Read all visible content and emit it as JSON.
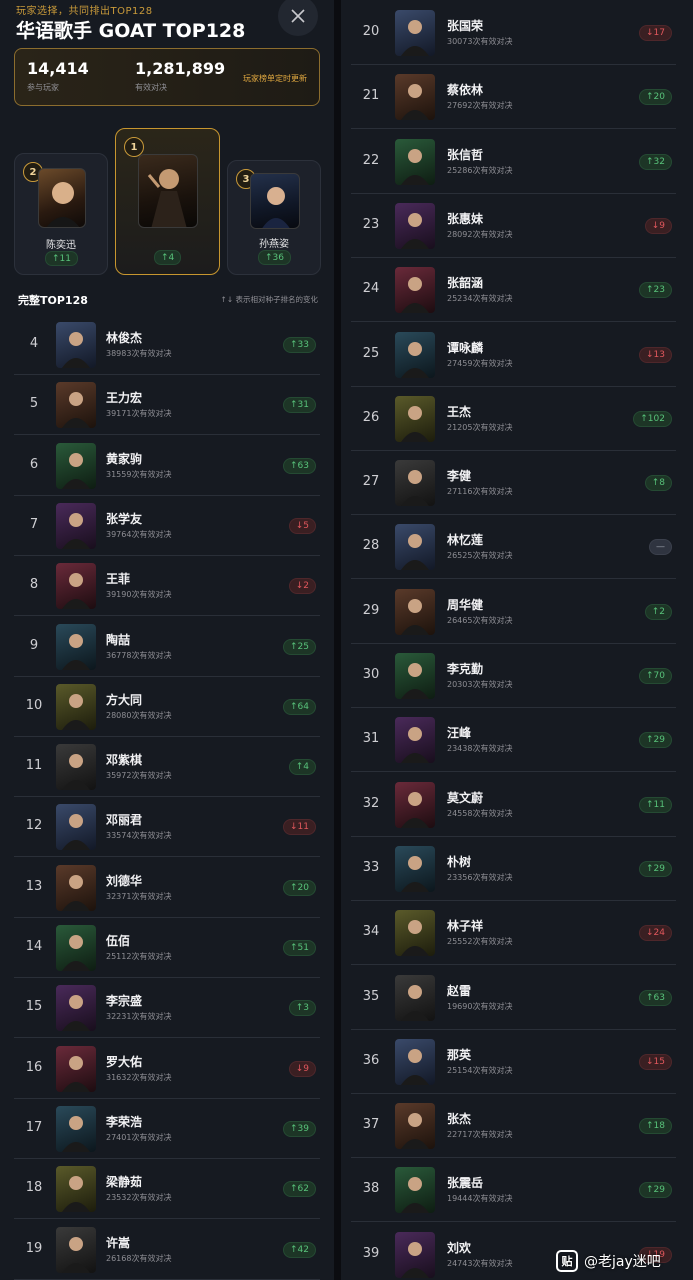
{
  "header": {
    "subtitle": "玩家选择，共同排出TOP128",
    "title": "华语歌手 GOAT TOP128",
    "close_icon": "close-icon"
  },
  "stats": {
    "players": "14,414",
    "players_label": "参与玩家",
    "matches": "1,281,899",
    "matches_label": "有效对决",
    "note": "玩家榜单定时更新"
  },
  "podium": [
    {
      "rank": "2",
      "name": "陈奕迅",
      "change": "↑11",
      "dir": "up"
    },
    {
      "rank": "1",
      "name": "",
      "change": "↑4",
      "dir": "up"
    },
    {
      "rank": "3",
      "name": "孙燕姿",
      "change": "↑36",
      "dir": "up"
    }
  ],
  "section": {
    "title": "完整TOP128",
    "note": "↑↓ 表示相对种子排名的变化"
  },
  "rows": [
    {
      "rank": "4",
      "name": "林俊杰",
      "count": "38983次有效对决",
      "change": "↑33",
      "dir": "up"
    },
    {
      "rank": "5",
      "name": "王力宏",
      "count": "39171次有效对决",
      "change": "↑31",
      "dir": "up"
    },
    {
      "rank": "6",
      "name": "黄家驹",
      "count": "31559次有效对决",
      "change": "↑63",
      "dir": "up"
    },
    {
      "rank": "7",
      "name": "张学友",
      "count": "39764次有效对决",
      "change": "↓5",
      "dir": "down"
    },
    {
      "rank": "8",
      "name": "王菲",
      "count": "39190次有效对决",
      "change": "↓2",
      "dir": "down"
    },
    {
      "rank": "9",
      "name": "陶喆",
      "count": "36778次有效对决",
      "change": "↑25",
      "dir": "up"
    },
    {
      "rank": "10",
      "name": "方大同",
      "count": "28080次有效对决",
      "change": "↑64",
      "dir": "up"
    },
    {
      "rank": "11",
      "name": "邓紫棋",
      "count": "35972次有效对决",
      "change": "↑4",
      "dir": "up"
    },
    {
      "rank": "12",
      "name": "邓丽君",
      "count": "33574次有效对决",
      "change": "↓11",
      "dir": "down"
    },
    {
      "rank": "13",
      "name": "刘德华",
      "count": "32371次有效对决",
      "change": "↑20",
      "dir": "up"
    },
    {
      "rank": "14",
      "name": "伍佰",
      "count": "25112次有效对决",
      "change": "↑51",
      "dir": "up"
    },
    {
      "rank": "15",
      "name": "李宗盛",
      "count": "32231次有效对决",
      "change": "↑3",
      "dir": "up"
    },
    {
      "rank": "16",
      "name": "罗大佑",
      "count": "31632次有效对决",
      "change": "↓9",
      "dir": "down"
    },
    {
      "rank": "17",
      "name": "李荣浩",
      "count": "27401次有效对决",
      "change": "↑39",
      "dir": "up"
    },
    {
      "rank": "18",
      "name": "梁静茹",
      "count": "23532次有效对决",
      "change": "↑62",
      "dir": "up"
    },
    {
      "rank": "19",
      "name": "许嵩",
      "count": "26168次有效对决",
      "change": "↑42",
      "dir": "up"
    },
    {
      "rank": "20",
      "name": "张国荣",
      "count": "30073次有效对决",
      "change": "↓17",
      "dir": "down"
    },
    {
      "rank": "21",
      "name": "蔡依林",
      "count": "27692次有效对决",
      "change": "↑20",
      "dir": "up"
    },
    {
      "rank": "22",
      "name": "张信哲",
      "count": "25286次有效对决",
      "change": "↑32",
      "dir": "up"
    },
    {
      "rank": "23",
      "name": "张惠妹",
      "count": "28092次有效对决",
      "change": "↓9",
      "dir": "down"
    },
    {
      "rank": "24",
      "name": "张韶涵",
      "count": "25234次有效对决",
      "change": "↑23",
      "dir": "up"
    },
    {
      "rank": "25",
      "name": "谭咏麟",
      "count": "27459次有效对决",
      "change": "↓13",
      "dir": "down"
    },
    {
      "rank": "26",
      "name": "王杰",
      "count": "21205次有效对决",
      "change": "↑102",
      "dir": "up"
    },
    {
      "rank": "27",
      "name": "李健",
      "count": "27116次有效对决",
      "change": "↑8",
      "dir": "up"
    },
    {
      "rank": "28",
      "name": "林忆莲",
      "count": "26525次有效对决",
      "change": "—",
      "dir": "flat"
    },
    {
      "rank": "29",
      "name": "周华健",
      "count": "26465次有效对决",
      "change": "↑2",
      "dir": "up"
    },
    {
      "rank": "30",
      "name": "李克勤",
      "count": "20303次有效对决",
      "change": "↑70",
      "dir": "up"
    },
    {
      "rank": "31",
      "name": "汪峰",
      "count": "23438次有效对决",
      "change": "↑29",
      "dir": "up"
    },
    {
      "rank": "32",
      "name": "莫文蔚",
      "count": "24558次有效对决",
      "change": "↑11",
      "dir": "up"
    },
    {
      "rank": "33",
      "name": "朴树",
      "count": "23356次有效对决",
      "change": "↑29",
      "dir": "up"
    },
    {
      "rank": "34",
      "name": "林子祥",
      "count": "25552次有效对决",
      "change": "↓24",
      "dir": "down"
    },
    {
      "rank": "35",
      "name": "赵雷",
      "count": "19690次有效对决",
      "change": "↑63",
      "dir": "up"
    },
    {
      "rank": "36",
      "name": "那英",
      "count": "25154次有效对决",
      "change": "↓15",
      "dir": "down"
    },
    {
      "rank": "37",
      "name": "张杰",
      "count": "22717次有效对决",
      "change": "↑18",
      "dir": "up"
    },
    {
      "rank": "38",
      "name": "张震岳",
      "count": "19444次有效对决",
      "change": "↑29",
      "dir": "up"
    },
    {
      "rank": "39",
      "name": "刘欢",
      "count": "24743次有效对决",
      "change": "↓19",
      "dir": "down"
    }
  ],
  "watermark": {
    "icon_text": "贴",
    "text": "@老jay迷吧"
  },
  "colors": {
    "gold": "#c99a3a",
    "up": "#58c27a",
    "down": "#e0575c"
  }
}
